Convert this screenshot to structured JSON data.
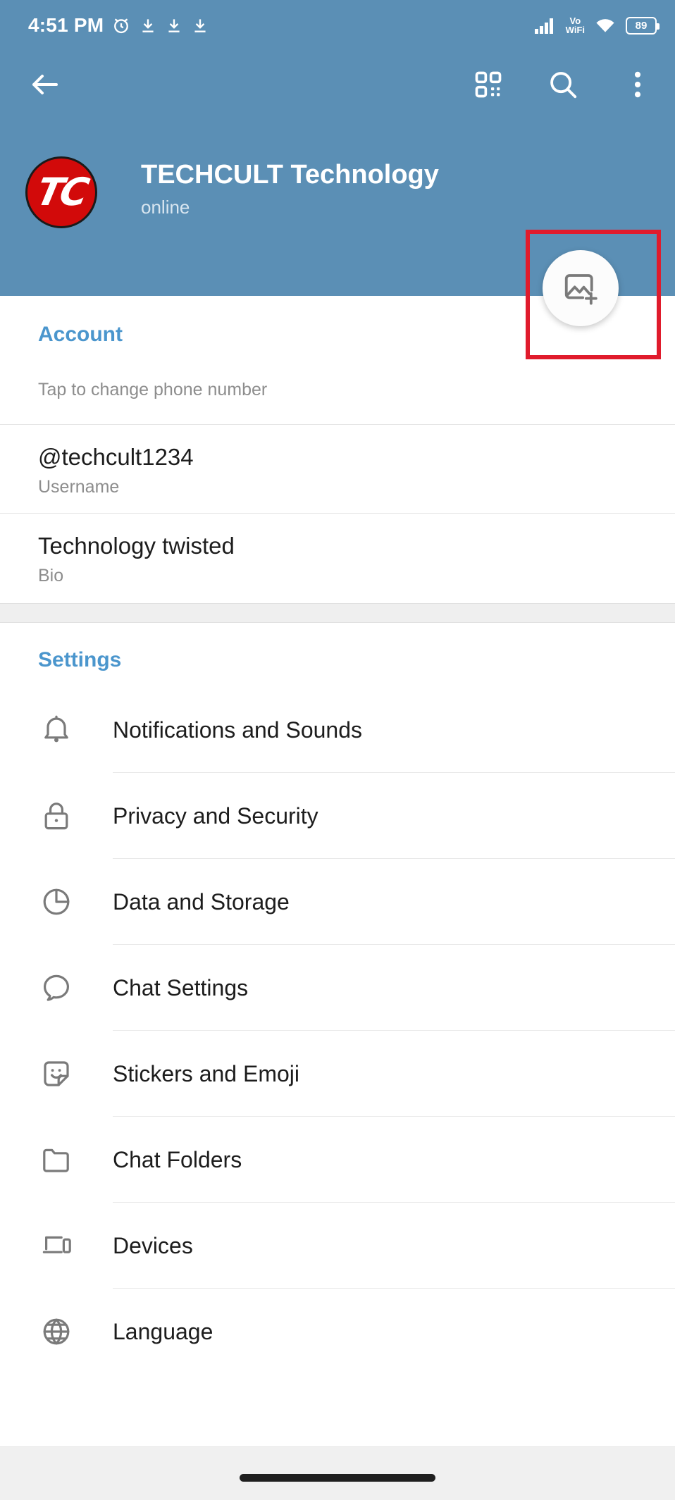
{
  "statusbar": {
    "time": "4:51 PM",
    "alarm_icon": "alarm-clock-icon",
    "download_icons": [
      "download-icon",
      "download-icon",
      "download-icon"
    ],
    "signal_icon": "cellular-signal-icon",
    "vowifi_line1": "Vo",
    "vowifi_line2": "WiFi",
    "wifi_icon": "wifi-icon",
    "battery_percent": "89"
  },
  "toolbar": {
    "back_label": "back-arrow",
    "qr_label": "qr-code",
    "search_label": "search",
    "overflow_label": "more-options"
  },
  "profile": {
    "avatar_initials": "TC",
    "name": "TECHCULT Technology",
    "status": "online"
  },
  "fab": {
    "label": "add-photo"
  },
  "account": {
    "title": "Account",
    "rows": [
      {
        "primary": "Tap to change phone number",
        "secondary": ""
      },
      {
        "primary": "@techcult1234",
        "secondary": "Username"
      },
      {
        "primary": "Technology twisted",
        "secondary": "Bio"
      }
    ]
  },
  "settings": {
    "title": "Settings",
    "items": [
      {
        "label": "Notifications and Sounds",
        "icon": "bell-icon"
      },
      {
        "label": "Privacy and Security",
        "icon": "lock-icon"
      },
      {
        "label": "Data and Storage",
        "icon": "pie-chart-icon"
      },
      {
        "label": "Chat Settings",
        "icon": "chat-bubble-icon"
      },
      {
        "label": "Stickers and Emoji",
        "icon": "sticker-icon"
      },
      {
        "label": "Chat Folders",
        "icon": "folder-icon"
      },
      {
        "label": "Devices",
        "icon": "devices-icon"
      },
      {
        "label": "Language",
        "icon": "globe-icon"
      }
    ]
  },
  "navbar": {
    "home_indicator": "home-gesture-bar"
  },
  "colors": {
    "header_blue": "#5b8fb5",
    "accent_blue": "#4b96cd",
    "avatar_red": "#d20a0a",
    "highlight_red": "#e01b2c",
    "icon_gray": "#7a7a7a",
    "text_primary": "#1d1d1d",
    "text_secondary": "#8d8d8d"
  }
}
